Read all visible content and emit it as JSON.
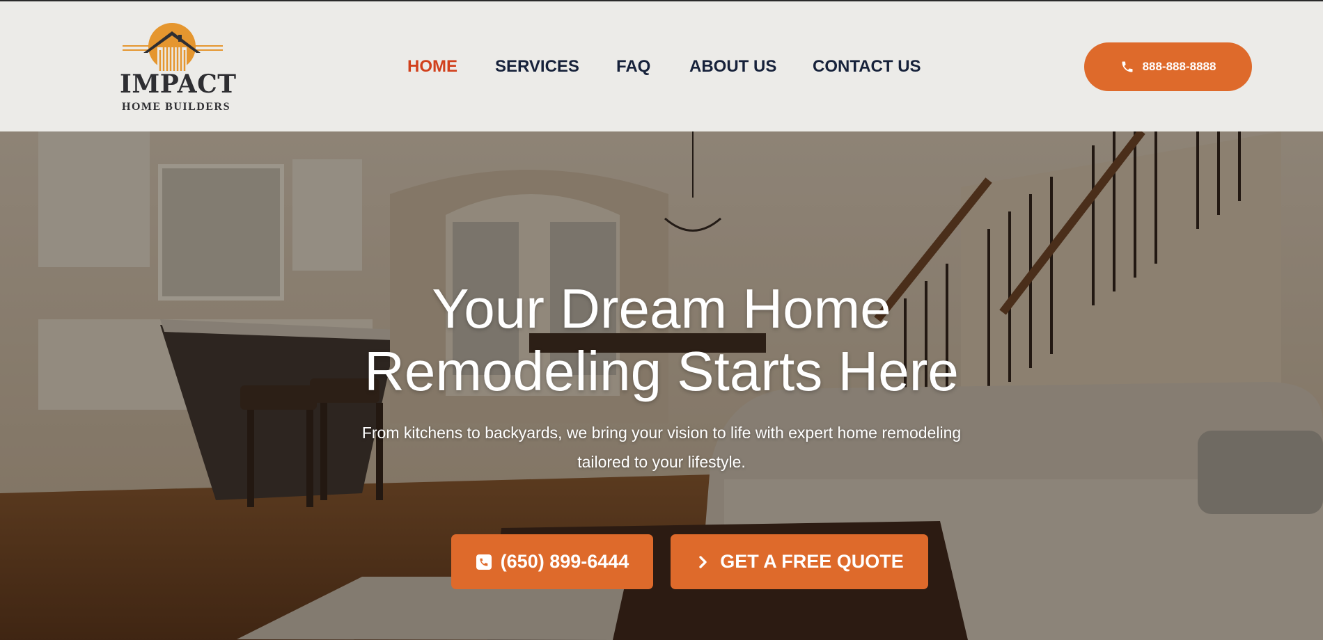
{
  "brand": {
    "name": "IMPACT",
    "tagline": "HOME BUILDERS",
    "accent": "#de6a2b"
  },
  "nav": {
    "items": [
      {
        "label": "HOME",
        "active": true
      },
      {
        "label": "SERVICES",
        "active": false
      },
      {
        "label": "FAQ",
        "active": false
      },
      {
        "label": "ABOUT US",
        "active": false
      },
      {
        "label": "CONTACT US",
        "active": false
      }
    ],
    "active_color": "#d1401c"
  },
  "header_phone": {
    "label": "888-888-8888",
    "icon": "phone-icon"
  },
  "hero": {
    "title_line1": "Your Dream Home",
    "title_line2": "Remodeling Starts Here",
    "subtitle_line1": "From kitchens to backyards, we bring your vision to life with expert home remodeling",
    "subtitle_line2": "tailored to your lifestyle.",
    "cta_phone": {
      "label": "(650) 899-6444",
      "icon": "phone-square-icon"
    },
    "cta_quote": {
      "label": "GET A FREE QUOTE",
      "icon": "chevron-right-icon"
    }
  }
}
